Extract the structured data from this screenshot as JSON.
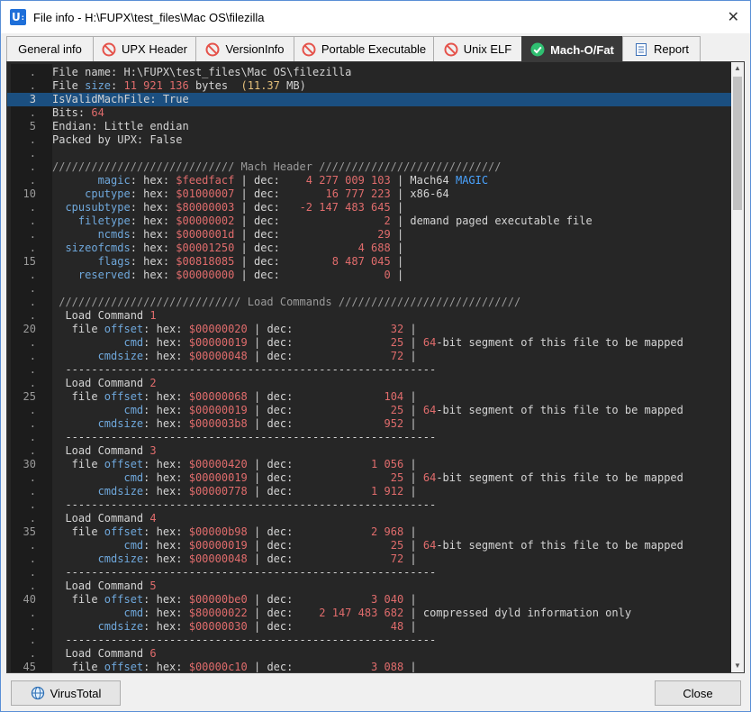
{
  "window": {
    "title": "File info - H:\\FUPX\\test_files\\Mac OS\\filezilla",
    "app_icon_text": "U"
  },
  "tabs": [
    {
      "label": "General info",
      "icon": "none"
    },
    {
      "label": "UPX Header",
      "icon": "no-entry-icon"
    },
    {
      "label": "VersionInfo",
      "icon": "no-entry-icon"
    },
    {
      "label": "Portable Executable",
      "icon": "no-entry-icon"
    },
    {
      "label": "Unix ELF",
      "icon": "no-entry-icon"
    },
    {
      "label": "Mach-O/Fat",
      "icon": "check-circle-icon"
    },
    {
      "label": "Report",
      "icon": "report-icon"
    }
  ],
  "colors": {
    "key": "#6fa8dc",
    "value": "#e06c6c",
    "size_mb": "#e5c07b",
    "selection": "#1b4f80"
  },
  "lines": [
    {
      "n": ".",
      "segs": [
        [
          "File name: ",
          ""
        ],
        [
          "H:\\FUPX\\test_files\\Mac OS\\filezilla",
          ""
        ]
      ]
    },
    {
      "n": ".",
      "segs": [
        [
          "File ",
          ""
        ],
        [
          "size",
          "k"
        ],
        [
          ": ",
          ""
        ],
        [
          "11 921 136",
          "v"
        ],
        [
          " bytes  ",
          ""
        ],
        [
          "(11.37",
          "y"
        ],
        [
          " MB)",
          ""
        ]
      ]
    },
    {
      "n": "3",
      "sel": true,
      "segs": [
        [
          "IsValidMachFile: True",
          ""
        ]
      ]
    },
    {
      "n": ".",
      "segs": [
        [
          "Bits: ",
          ""
        ],
        [
          "64",
          "v"
        ]
      ]
    },
    {
      "n": "5",
      "segs": [
        [
          "Endian: Little endian",
          ""
        ]
      ]
    },
    {
      "n": ".",
      "segs": [
        [
          "Packed by UPX: False",
          ""
        ]
      ]
    },
    {
      "n": ".",
      "segs": [
        [
          "",
          ""
        ]
      ]
    },
    {
      "n": ".",
      "segs": [
        [
          "//////////////////////////// Mach Header ////////////////////////////",
          "m"
        ]
      ]
    },
    {
      "n": ".",
      "segs": [
        [
          "       ",
          ""
        ],
        [
          "magic",
          "k"
        ],
        [
          ": hex: ",
          ""
        ],
        [
          "$feedfacf",
          "v"
        ],
        [
          " | dec:    ",
          ""
        ],
        [
          "4 277 009 103",
          "v"
        ],
        [
          " | Mach64 ",
          ""
        ],
        [
          "MAGIC",
          "b"
        ]
      ]
    },
    {
      "n": "10",
      "segs": [
        [
          "     ",
          ""
        ],
        [
          "cputype",
          "k"
        ],
        [
          ": hex: ",
          ""
        ],
        [
          "$01000007",
          "v"
        ],
        [
          " | dec:       ",
          ""
        ],
        [
          "16 777 223",
          "v"
        ],
        [
          " | x86-64",
          ""
        ]
      ]
    },
    {
      "n": ".",
      "segs": [
        [
          "  ",
          ""
        ],
        [
          "cpusubtype",
          "k"
        ],
        [
          ": hex: ",
          ""
        ],
        [
          "$80000003",
          "v"
        ],
        [
          " | dec:   ",
          ""
        ],
        [
          "-2 147 483 645",
          "v"
        ],
        [
          " |",
          ""
        ]
      ]
    },
    {
      "n": ".",
      "segs": [
        [
          "    ",
          ""
        ],
        [
          "filetype",
          "k"
        ],
        [
          ": hex: ",
          ""
        ],
        [
          "$00000002",
          "v"
        ],
        [
          " | dec:                ",
          ""
        ],
        [
          "2",
          "v"
        ],
        [
          " | demand paged executable file",
          ""
        ]
      ]
    },
    {
      "n": ".",
      "segs": [
        [
          "       ",
          ""
        ],
        [
          "ncmds",
          "k"
        ],
        [
          ": hex: ",
          ""
        ],
        [
          "$0000001d",
          "v"
        ],
        [
          " | dec:               ",
          ""
        ],
        [
          "29",
          "v"
        ],
        [
          " |",
          ""
        ]
      ]
    },
    {
      "n": ".",
      "segs": [
        [
          "  ",
          ""
        ],
        [
          "sizeofcmds",
          "k"
        ],
        [
          ": hex: ",
          ""
        ],
        [
          "$00001250",
          "v"
        ],
        [
          " | dec:            ",
          ""
        ],
        [
          "4 688",
          "v"
        ],
        [
          " |",
          ""
        ]
      ]
    },
    {
      "n": "15",
      "segs": [
        [
          "       ",
          ""
        ],
        [
          "flags",
          "k"
        ],
        [
          ": hex: ",
          ""
        ],
        [
          "$00818085",
          "v"
        ],
        [
          " | dec:        ",
          ""
        ],
        [
          "8 487 045",
          "v"
        ],
        [
          " |",
          ""
        ]
      ]
    },
    {
      "n": ".",
      "segs": [
        [
          "    ",
          ""
        ],
        [
          "reserved",
          "k"
        ],
        [
          ": hex: ",
          ""
        ],
        [
          "$00000000",
          "v"
        ],
        [
          " | dec:                ",
          ""
        ],
        [
          "0",
          "v"
        ],
        [
          " |",
          ""
        ]
      ]
    },
    {
      "n": ".",
      "segs": [
        [
          "",
          ""
        ]
      ]
    },
    {
      "n": ".",
      "segs": [
        [
          " //////////////////////////// Load Commands ////////////////////////////",
          "m"
        ]
      ]
    },
    {
      "n": ".",
      "segs": [
        [
          "  Load Command ",
          ""
        ],
        [
          "1",
          "v"
        ]
      ]
    },
    {
      "n": "20",
      "segs": [
        [
          "   file ",
          ""
        ],
        [
          "offset",
          "k"
        ],
        [
          ": hex: ",
          ""
        ],
        [
          "$00000020",
          "v"
        ],
        [
          " | dec:               ",
          ""
        ],
        [
          "32",
          "v"
        ],
        [
          " |",
          ""
        ]
      ]
    },
    {
      "n": ".",
      "segs": [
        [
          "           ",
          ""
        ],
        [
          "cmd",
          "k"
        ],
        [
          ": hex: ",
          ""
        ],
        [
          "$00000019",
          "v"
        ],
        [
          " | dec:               ",
          ""
        ],
        [
          "25",
          "v"
        ],
        [
          " | ",
          ""
        ],
        [
          "64",
          "v"
        ],
        [
          "-bit segment of this file to be mapped",
          ""
        ]
      ]
    },
    {
      "n": ".",
      "segs": [
        [
          "       ",
          ""
        ],
        [
          "cmdsize",
          "k"
        ],
        [
          ": hex: ",
          ""
        ],
        [
          "$00000048",
          "v"
        ],
        [
          " | dec:               ",
          ""
        ],
        [
          "72",
          "v"
        ],
        [
          " |",
          ""
        ]
      ]
    },
    {
      "n": ".",
      "segs": [
        [
          "  ---------------------------------------------------------",
          ""
        ]
      ]
    },
    {
      "n": ".",
      "segs": [
        [
          "  Load Command ",
          ""
        ],
        [
          "2",
          "v"
        ]
      ]
    },
    {
      "n": "25",
      "segs": [
        [
          "   file ",
          ""
        ],
        [
          "offset",
          "k"
        ],
        [
          ": hex: ",
          ""
        ],
        [
          "$00000068",
          "v"
        ],
        [
          " | dec:              ",
          ""
        ],
        [
          "104",
          "v"
        ],
        [
          " |",
          ""
        ]
      ]
    },
    {
      "n": ".",
      "segs": [
        [
          "           ",
          ""
        ],
        [
          "cmd",
          "k"
        ],
        [
          ": hex: ",
          ""
        ],
        [
          "$00000019",
          "v"
        ],
        [
          " | dec:               ",
          ""
        ],
        [
          "25",
          "v"
        ],
        [
          " | ",
          ""
        ],
        [
          "64",
          "v"
        ],
        [
          "-bit segment of this file to be mapped",
          ""
        ]
      ]
    },
    {
      "n": ".",
      "segs": [
        [
          "       ",
          ""
        ],
        [
          "cmdsize",
          "k"
        ],
        [
          ": hex: ",
          ""
        ],
        [
          "$000003b8",
          "v"
        ],
        [
          " | dec:              ",
          ""
        ],
        [
          "952",
          "v"
        ],
        [
          " |",
          ""
        ]
      ]
    },
    {
      "n": ".",
      "segs": [
        [
          "  ---------------------------------------------------------",
          ""
        ]
      ]
    },
    {
      "n": ".",
      "segs": [
        [
          "  Load Command ",
          ""
        ],
        [
          "3",
          "v"
        ]
      ]
    },
    {
      "n": "30",
      "segs": [
        [
          "   file ",
          ""
        ],
        [
          "offset",
          "k"
        ],
        [
          ": hex: ",
          ""
        ],
        [
          "$00000420",
          "v"
        ],
        [
          " | dec:            ",
          ""
        ],
        [
          "1 056",
          "v"
        ],
        [
          " |",
          ""
        ]
      ]
    },
    {
      "n": ".",
      "segs": [
        [
          "           ",
          ""
        ],
        [
          "cmd",
          "k"
        ],
        [
          ": hex: ",
          ""
        ],
        [
          "$00000019",
          "v"
        ],
        [
          " | dec:               ",
          ""
        ],
        [
          "25",
          "v"
        ],
        [
          " | ",
          ""
        ],
        [
          "64",
          "v"
        ],
        [
          "-bit segment of this file to be mapped",
          ""
        ]
      ]
    },
    {
      "n": ".",
      "segs": [
        [
          "       ",
          ""
        ],
        [
          "cmdsize",
          "k"
        ],
        [
          ": hex: ",
          ""
        ],
        [
          "$00000778",
          "v"
        ],
        [
          " | dec:            ",
          ""
        ],
        [
          "1 912",
          "v"
        ],
        [
          " |",
          ""
        ]
      ]
    },
    {
      "n": ".",
      "segs": [
        [
          "  ---------------------------------------------------------",
          ""
        ]
      ]
    },
    {
      "n": ".",
      "segs": [
        [
          "  Load Command ",
          ""
        ],
        [
          "4",
          "v"
        ]
      ]
    },
    {
      "n": "35",
      "segs": [
        [
          "   file ",
          ""
        ],
        [
          "offset",
          "k"
        ],
        [
          ": hex: ",
          ""
        ],
        [
          "$00000b98",
          "v"
        ],
        [
          " | dec:            ",
          ""
        ],
        [
          "2 968",
          "v"
        ],
        [
          " |",
          ""
        ]
      ]
    },
    {
      "n": ".",
      "segs": [
        [
          "           ",
          ""
        ],
        [
          "cmd",
          "k"
        ],
        [
          ": hex: ",
          ""
        ],
        [
          "$00000019",
          "v"
        ],
        [
          " | dec:               ",
          ""
        ],
        [
          "25",
          "v"
        ],
        [
          " | ",
          ""
        ],
        [
          "64",
          "v"
        ],
        [
          "-bit segment of this file to be mapped",
          ""
        ]
      ]
    },
    {
      "n": ".",
      "segs": [
        [
          "       ",
          ""
        ],
        [
          "cmdsize",
          "k"
        ],
        [
          ": hex: ",
          ""
        ],
        [
          "$00000048",
          "v"
        ],
        [
          " | dec:               ",
          ""
        ],
        [
          "72",
          "v"
        ],
        [
          " |",
          ""
        ]
      ]
    },
    {
      "n": ".",
      "segs": [
        [
          "  ---------------------------------------------------------",
          ""
        ]
      ]
    },
    {
      "n": ".",
      "segs": [
        [
          "  Load Command ",
          ""
        ],
        [
          "5",
          "v"
        ]
      ]
    },
    {
      "n": "40",
      "segs": [
        [
          "   file ",
          ""
        ],
        [
          "offset",
          "k"
        ],
        [
          ": hex: ",
          ""
        ],
        [
          "$00000be0",
          "v"
        ],
        [
          " | dec:            ",
          ""
        ],
        [
          "3 040",
          "v"
        ],
        [
          " |",
          ""
        ]
      ]
    },
    {
      "n": ".",
      "segs": [
        [
          "           ",
          ""
        ],
        [
          "cmd",
          "k"
        ],
        [
          ": hex: ",
          ""
        ],
        [
          "$80000022",
          "v"
        ],
        [
          " | dec:    ",
          ""
        ],
        [
          "2 147 483 682",
          "v"
        ],
        [
          " | compressed dyld information only",
          ""
        ]
      ]
    },
    {
      "n": ".",
      "segs": [
        [
          "       ",
          ""
        ],
        [
          "cmdsize",
          "k"
        ],
        [
          ": hex: ",
          ""
        ],
        [
          "$00000030",
          "v"
        ],
        [
          " | dec:               ",
          ""
        ],
        [
          "48",
          "v"
        ],
        [
          " |",
          ""
        ]
      ]
    },
    {
      "n": ".",
      "segs": [
        [
          "  ---------------------------------------------------------",
          ""
        ]
      ]
    },
    {
      "n": ".",
      "segs": [
        [
          "  Load Command ",
          ""
        ],
        [
          "6",
          "v"
        ]
      ]
    },
    {
      "n": "45",
      "segs": [
        [
          "   file ",
          ""
        ],
        [
          "offset",
          "k"
        ],
        [
          ": hex: ",
          ""
        ],
        [
          "$00000c10",
          "v"
        ],
        [
          " | dec:            ",
          ""
        ],
        [
          "3 088",
          "v"
        ],
        [
          " |",
          ""
        ]
      ]
    }
  ],
  "buttons": {
    "virustotal": "VirusTotal",
    "close": "Close"
  }
}
